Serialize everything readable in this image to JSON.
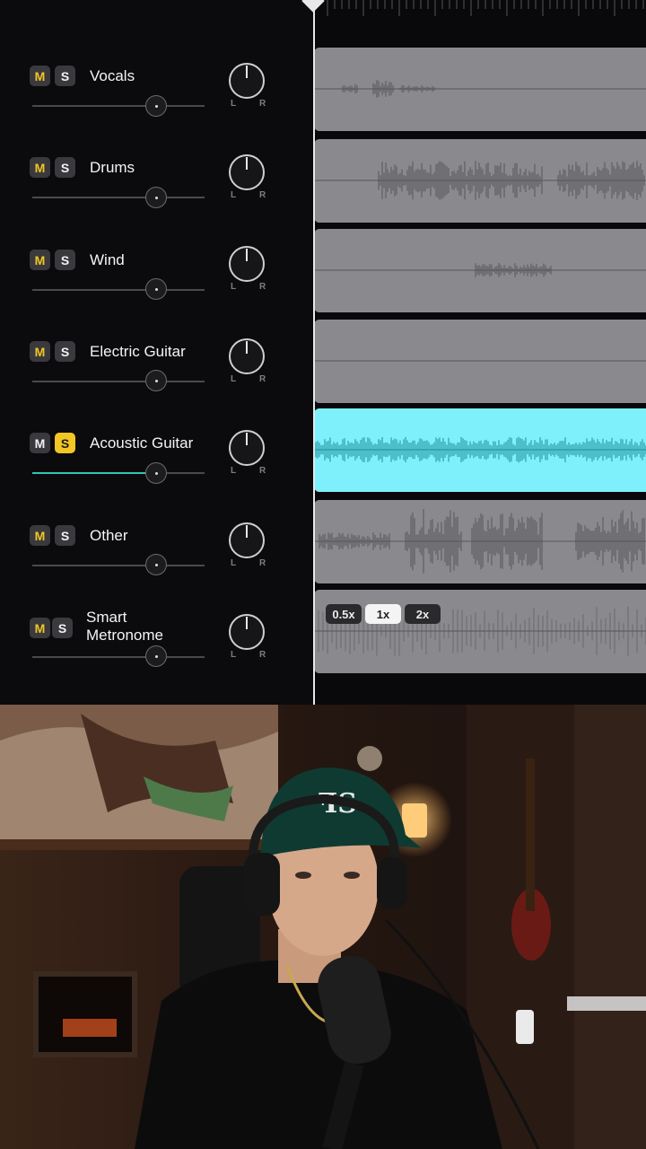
{
  "tracks": [
    {
      "name": "Vocals",
      "mute_label": "M",
      "solo_label": "S",
      "muted": true,
      "solo": false,
      "volume": 0.72,
      "pan": 0
    },
    {
      "name": "Drums",
      "mute_label": "M",
      "solo_label": "S",
      "muted": true,
      "solo": false,
      "volume": 0.72,
      "pan": 0
    },
    {
      "name": "Wind",
      "mute_label": "M",
      "solo_label": "S",
      "muted": true,
      "solo": false,
      "volume": 0.72,
      "pan": 0
    },
    {
      "name": "Electric Guitar",
      "mute_label": "M",
      "solo_label": "S",
      "muted": true,
      "solo": false,
      "volume": 0.72,
      "pan": 0
    },
    {
      "name": "Acoustic Guitar",
      "mute_label": "M",
      "solo_label": "S",
      "muted": false,
      "solo": true,
      "volume": 0.72,
      "pan": 0
    },
    {
      "name": "Other",
      "mute_label": "M",
      "solo_label": "S",
      "muted": true,
      "solo": false,
      "volume": 0.72,
      "pan": 0
    },
    {
      "name_line1": "Smart",
      "name_line2": "Metronome",
      "mute_label": "M",
      "solo_label": "S",
      "muted": true,
      "solo": false,
      "volume": 0.72,
      "pan": 0
    }
  ],
  "pan_labels": {
    "left": "L",
    "right": "R"
  },
  "metronome_speeds": [
    {
      "label": "0.5x",
      "active": false
    },
    {
      "label": "1x",
      "active": true
    },
    {
      "label": "2x",
      "active": false
    }
  ],
  "colors": {
    "accent_yellow": "#f2c624",
    "accent_teal": "#2fc8b6",
    "selected_lane": "#7df0fb",
    "lane_gray": "#8a8a8e"
  }
}
